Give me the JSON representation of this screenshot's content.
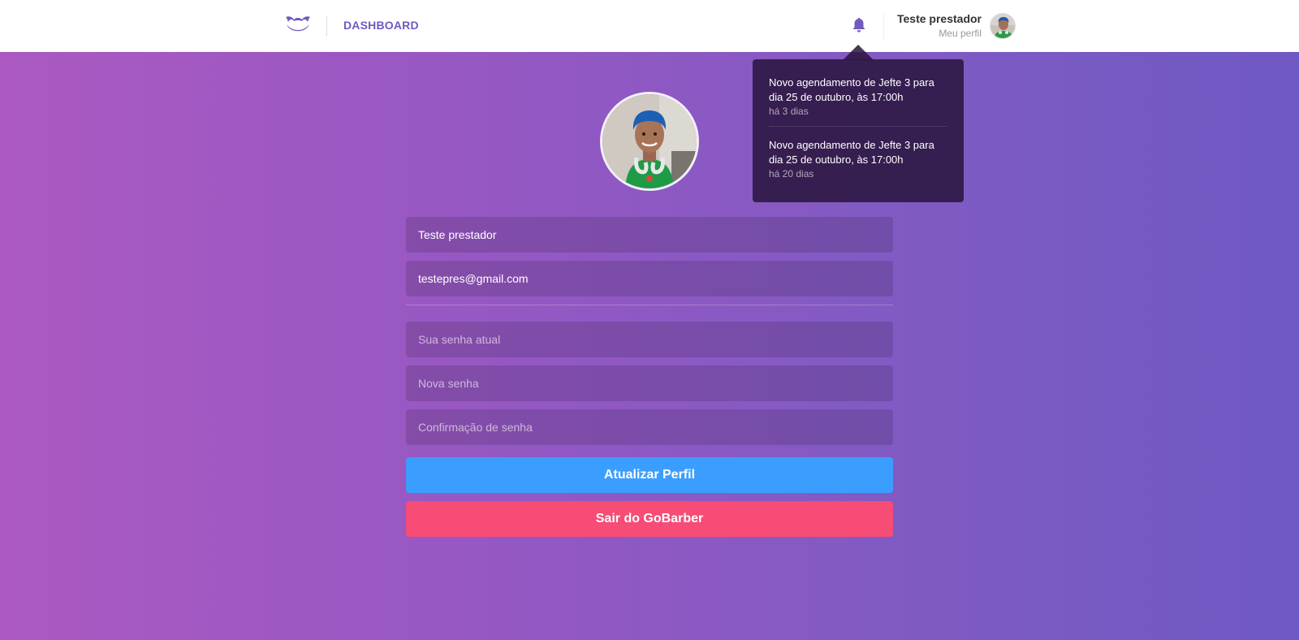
{
  "header": {
    "logo_icon": "gobarber-mustache-icon",
    "nav_dashboard": "DASHBOARD",
    "bell_icon": "bell-icon",
    "profile_name": "Teste prestador",
    "profile_link": "Meu perfil",
    "brand_color": "#7159c1"
  },
  "notifications": [
    {
      "text": "Novo agendamento de Jefte 3 para dia 25 de outubro, às 17:00h",
      "time": "há 3 dias"
    },
    {
      "text": "Novo agendamento de Jefte 3 para dia 25 de outubro, às 17:00h",
      "time": "há 20 dias"
    }
  ],
  "form": {
    "name_value": "Teste prestador",
    "email_value": "testepres@gmail.com",
    "old_password_placeholder": "Sua senha atual",
    "new_password_placeholder": "Nova senha",
    "confirm_password_placeholder": "Confirmação de senha",
    "update_button": "Atualizar Perfil",
    "logout_button": "Sair do GoBarber"
  },
  "colors": {
    "update_button": "#3b9eff",
    "logout_button": "#f64c75"
  }
}
